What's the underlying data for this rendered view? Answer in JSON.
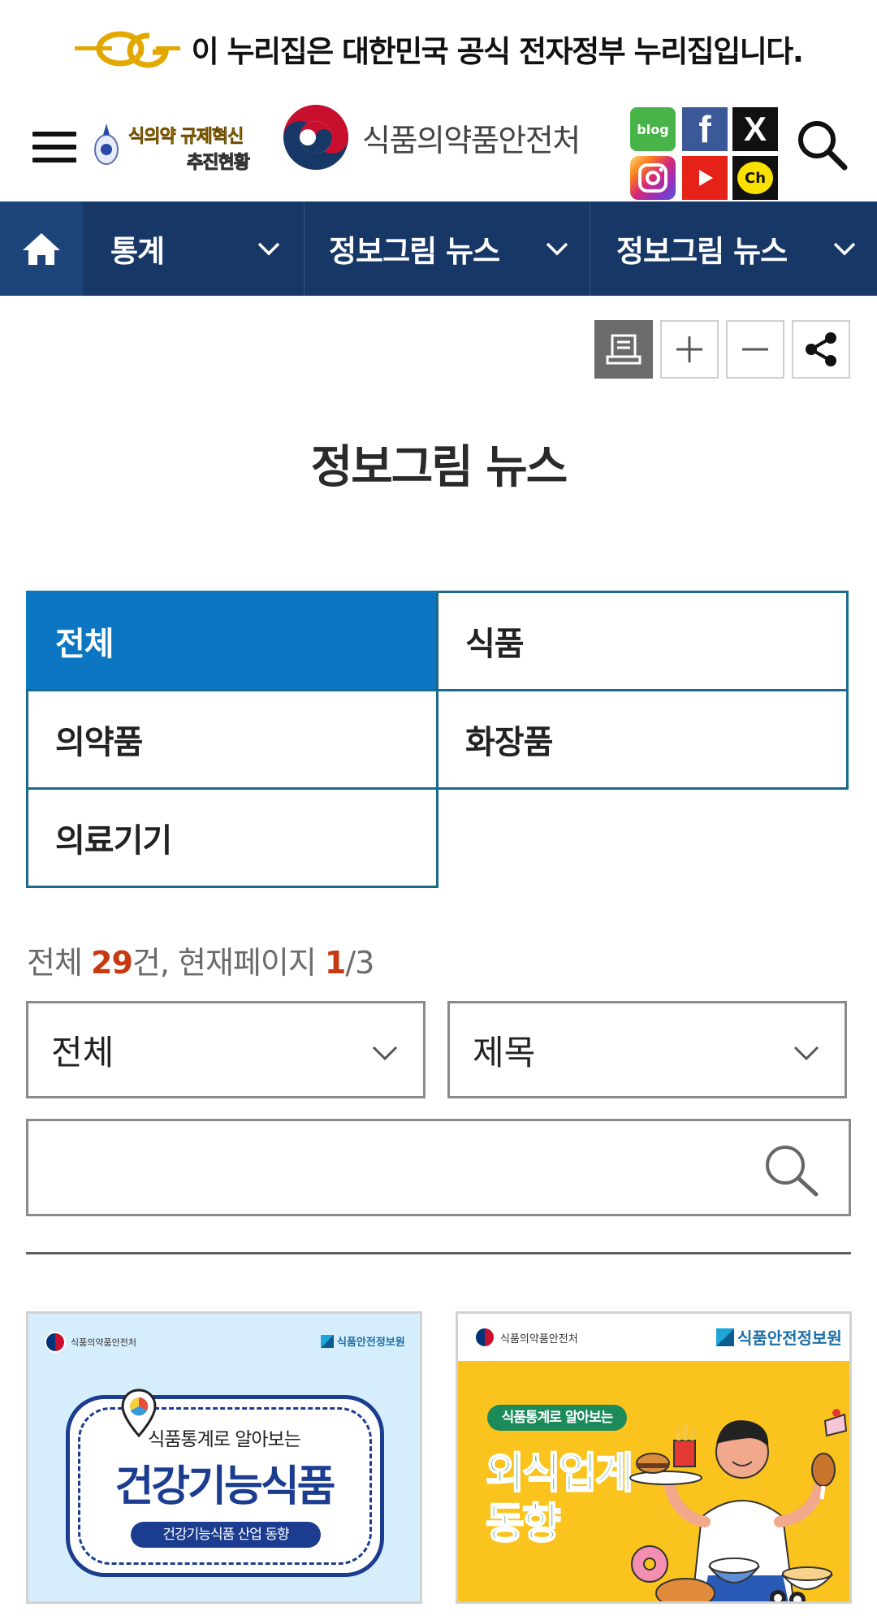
{
  "gov_banner": {
    "text": "이 누리집은 대한민국 공식 전자정부 누리집입니다."
  },
  "header": {
    "promo_line1": "식의약 규제혁신",
    "promo_line2": "추진현황",
    "org_name": "식품의약품안전처",
    "sns": [
      {
        "name": "blog",
        "label": "blog",
        "color": "#47b349"
      },
      {
        "name": "facebook",
        "label": "f",
        "color": "#3b5998"
      },
      {
        "name": "x",
        "label": "X",
        "color": "#111111"
      },
      {
        "name": "instagram",
        "label": "",
        "color": "#d62976"
      },
      {
        "name": "youtube",
        "label": "",
        "color": "#e62117"
      },
      {
        "name": "kakao-channel",
        "label": "Ch",
        "color": "#fae100"
      }
    ]
  },
  "nav": {
    "items": [
      {
        "label": "통계"
      },
      {
        "label": "정보그림 뉴스"
      },
      {
        "label": "정보그림 뉴스"
      }
    ],
    "background": "#173766"
  },
  "page": {
    "title": "정보그림 뉴스"
  },
  "tabs": [
    {
      "label": "전체",
      "active": true
    },
    {
      "label": "식품",
      "active": false
    },
    {
      "label": "의약품",
      "active": false
    },
    {
      "label": "화장품",
      "active": false
    },
    {
      "label": "의료기기",
      "active": false
    }
  ],
  "count": {
    "prefix": "전체 ",
    "total": "29",
    "mid": "건, 현재페이지 ",
    "current": "1",
    "suffix": "/3"
  },
  "filters": {
    "category_value": "전체",
    "field_value": "제목",
    "search_value": ""
  },
  "cards": [
    {
      "logo_left": "식품의약품안전처",
      "logo_right": "식품안전정보원",
      "subtitle": "식품통계로 알아보는",
      "title": "건강기능식품",
      "pill": "건강기능식품 산업 동향"
    },
    {
      "logo_left": "식품의약품안전처",
      "logo_right": "식품안전정보원",
      "pill": "식품통계로 알아보는",
      "title_line1": "외식업계",
      "title_line2": "동향"
    }
  ],
  "colors": {
    "active_tab": "#0d76c2",
    "accent_number": "#c53a10",
    "nav": "#173766"
  }
}
